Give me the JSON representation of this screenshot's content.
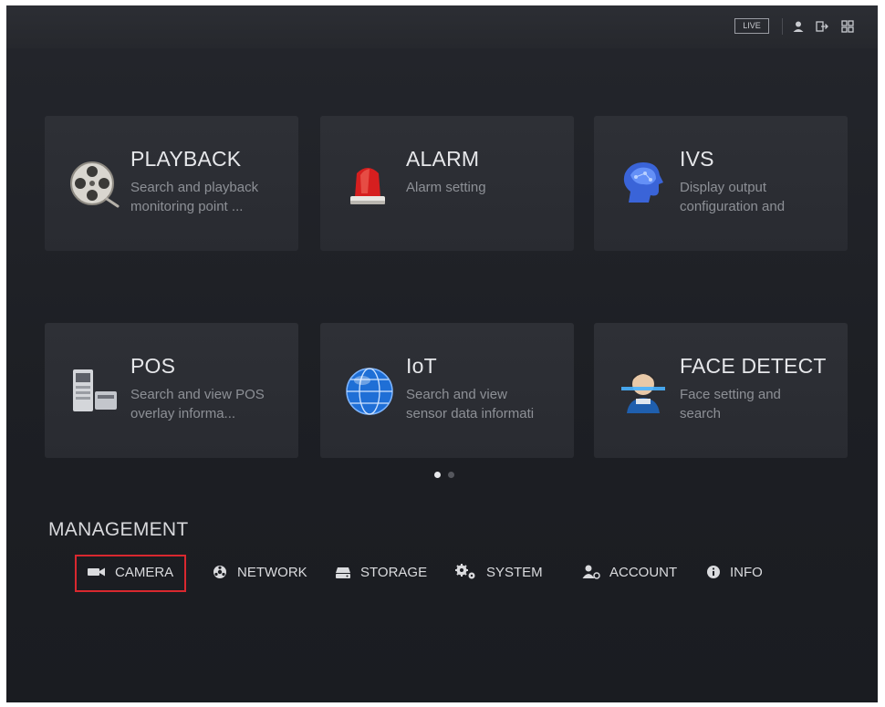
{
  "topbar": {
    "live_label": "LIVE",
    "icons": [
      "user-icon",
      "logout-icon",
      "grid-icon"
    ]
  },
  "cards": [
    {
      "title": "PLAYBACK",
      "desc": [
        "Search and playback",
        "monitoring point ..."
      ],
      "icon": "film-reel-icon"
    },
    {
      "title": "ALARM",
      "desc": [
        "Alarm setting"
      ],
      "icon": "alarm-beacon-icon"
    },
    {
      "title": "IVS",
      "desc": [
        "Display output",
        "configuration and"
      ],
      "icon": "brain-head-icon"
    },
    {
      "title": "POS",
      "desc": [
        "Search and view POS",
        "overlay informa..."
      ],
      "icon": "pos-terminal-icon"
    },
    {
      "title": "IoT",
      "desc": [
        "Search and view",
        "sensor data informati"
      ],
      "icon": "globe-icon"
    },
    {
      "title": "FACE DETECT",
      "desc": [
        "Face setting and",
        "search"
      ],
      "icon": "face-scan-icon"
    }
  ],
  "pager": {
    "active_index": 0,
    "count": 2
  },
  "management": {
    "title": "MANAGEMENT",
    "items": [
      {
        "label": "CAMERA",
        "icon": "camera-icon",
        "selected": true
      },
      {
        "label": "NETWORK",
        "icon": "network-icon"
      },
      {
        "label": "STORAGE",
        "icon": "storage-icon"
      },
      {
        "label": "SYSTEM",
        "icon": "gears-icon"
      },
      {
        "label": "ACCOUNT",
        "icon": "account-icon"
      },
      {
        "label": "INFO",
        "icon": "info-icon"
      }
    ]
  },
  "colors": {
    "background": "#1d1f24",
    "card": "#2c2e34",
    "title_text": "#e6e7ea",
    "desc_text": "#8d9096",
    "highlight_border": "#d9282f"
  }
}
